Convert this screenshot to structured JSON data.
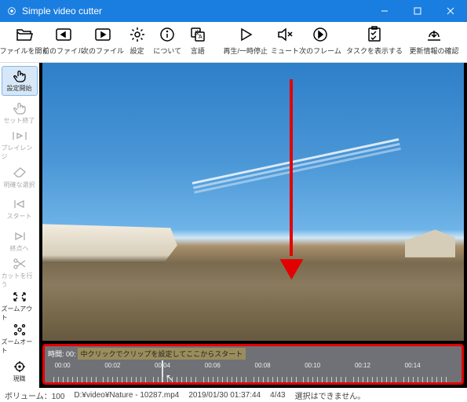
{
  "window": {
    "title": "Simple video cutter"
  },
  "toolbar": [
    {
      "id": "open-file",
      "label": "ファイルを開く"
    },
    {
      "id": "prev-file",
      "label": "前のファイル"
    },
    {
      "id": "next-file",
      "label": "次のファイル"
    },
    {
      "id": "settings",
      "label": "設定"
    },
    {
      "id": "about",
      "label": "について"
    },
    {
      "id": "language",
      "label": "言語"
    },
    {
      "id": "play-pause",
      "label": "再生/一時停止"
    },
    {
      "id": "mute",
      "label": "ミュート"
    },
    {
      "id": "next-frame",
      "label": "次のフレーム"
    },
    {
      "id": "show-tasks",
      "label": "タスクを表示する"
    },
    {
      "id": "check-update",
      "label": "更新情報の確認"
    }
  ],
  "sidebar": [
    {
      "id": "set-start",
      "label": "設定開始",
      "active": true
    },
    {
      "id": "set-end",
      "label": "セット終了",
      "gray": true
    },
    {
      "id": "playrange",
      "label": "プレイレンジ",
      "gray": true
    },
    {
      "id": "clear-sel",
      "label": "明確な選択",
      "gray": true
    },
    {
      "id": "start",
      "label": "スタート",
      "gray": true
    },
    {
      "id": "end",
      "label": "終点へ",
      "gray": true
    },
    {
      "id": "do-cut",
      "label": "カットを行う",
      "gray": true
    },
    {
      "id": "zoom-out",
      "label": "ズームアウト"
    },
    {
      "id": "zoom-auto",
      "label": "ズームオート"
    },
    {
      "id": "current",
      "label": "現職"
    }
  ],
  "timeline": {
    "time_prefix": "時間:",
    "time_value": "00:",
    "hint": "中クリックでクリップを設定してここからスタート",
    "ticks": [
      "00:00",
      "00:02",
      "00:04",
      "00:06",
      "00:08",
      "00:10",
      "00:12",
      "00:14"
    ]
  },
  "status": {
    "volume_label": "ボリューム：",
    "volume_value": "100",
    "filepath": "D:¥video¥Nature - 10287.mp4",
    "datetime": "2019/01/30 01:37:44",
    "frame": "4/43",
    "selection": "選択はできません。"
  }
}
